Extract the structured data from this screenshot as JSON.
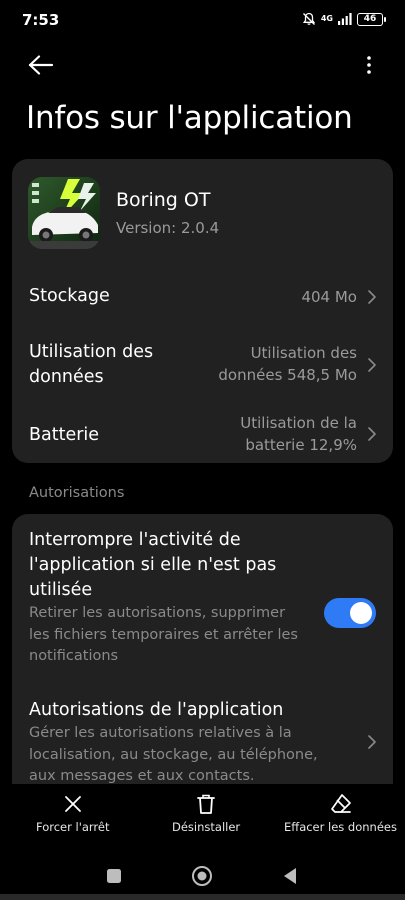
{
  "status": {
    "time": "7:53",
    "network": "4G",
    "battery": "46"
  },
  "page": {
    "title": "Infos sur l'application"
  },
  "app": {
    "name": "Boring OT",
    "version": "Version: 2.0.4"
  },
  "info_rows": [
    {
      "label": "Stockage",
      "value": "404 Mo"
    },
    {
      "label_line1": "Utilisation des",
      "label_line2": "données",
      "value_line1": "Utilisation des",
      "value_line2": "données 548,5 Mo"
    },
    {
      "label": "Batterie",
      "value_line1": "Utilisation de la",
      "value_line2": "batterie 12,9%"
    }
  ],
  "permissions_section": {
    "label": "Autorisations"
  },
  "pause_activity": {
    "title_lines": [
      "Interrompre l'activité de",
      "l'application si elle n'est pas",
      "utilisée"
    ],
    "desc_lines": [
      "Retirer les autorisations, supprimer",
      "les fichiers temporaires et arrêter les",
      "notifications"
    ],
    "enabled": true
  },
  "app_permissions": {
    "title": "Autorisations de l'application",
    "desc_lines": [
      "Gérer les autorisations relatives à la",
      "localisation, au stockage, au téléphone,",
      "aux messages et aux contacts."
    ]
  },
  "actions": {
    "force_stop": "Forcer l'arrêt",
    "uninstall": "Désinstaller",
    "clear_data": "Effacer les données"
  },
  "colors": {
    "background": "#000000",
    "card": "#212121",
    "accent": "#2f7bf6",
    "secondary_text": "#9a9a9a"
  },
  "icons": [
    "back-arrow-icon",
    "more-vert-icon",
    "chevron-right-icon",
    "close-icon",
    "trash-icon",
    "eraser-icon",
    "recents-square-icon",
    "home-circle-icon",
    "back-triangle-icon",
    "mute-bell-icon",
    "signal-icon",
    "battery-icon"
  ]
}
